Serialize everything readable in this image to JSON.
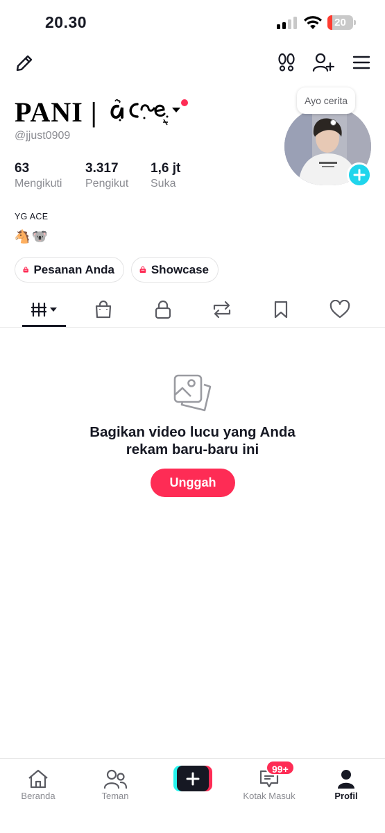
{
  "status_bar": {
    "time": "20.30",
    "battery_percent": "20",
    "battery_level": 0.2
  },
  "header": {
    "display_name": "PANI | ",
    "username": "@jjust0909"
  },
  "stats": [
    {
      "value": "63",
      "label": "Mengikuti"
    },
    {
      "value": "3.317",
      "label": "Pengikut"
    },
    {
      "value": "1,6 jt",
      "label": "Suka"
    }
  ],
  "bio": {
    "text": "YG ACE",
    "emojis": [
      "🐴",
      "🐨"
    ]
  },
  "buttons": {
    "orders_label": "Pesanan Anda",
    "showcase_label": "Showcase"
  },
  "avatar": {
    "bubble_text": "Ayo cerita"
  },
  "tabs": [
    {
      "icon": "grid-icon",
      "active": true
    },
    {
      "icon": "shopping-bag-icon"
    },
    {
      "icon": "lock-icon"
    },
    {
      "icon": "repost-icon"
    },
    {
      "icon": "bookmark-icon"
    },
    {
      "icon": "heart-icon"
    }
  ],
  "empty_state": {
    "line1": "Bagikan video lucu yang Anda",
    "line2": "rekam baru-baru ini",
    "button_label": "Unggah"
  },
  "bottom_nav": {
    "items": [
      {
        "label": "Beranda",
        "icon": "home-icon"
      },
      {
        "label": "Teman",
        "icon": "friends-icon"
      },
      {
        "label": "Kotak Masuk",
        "icon": "inbox-icon",
        "badge": "99+"
      },
      {
        "label": "Profil",
        "icon": "profile-icon",
        "active": true
      }
    ]
  },
  "colors": {
    "accent": "#fe2c55",
    "cyan": "#25f4ee",
    "text": "#161823",
    "secondary": "#8a8b91"
  }
}
